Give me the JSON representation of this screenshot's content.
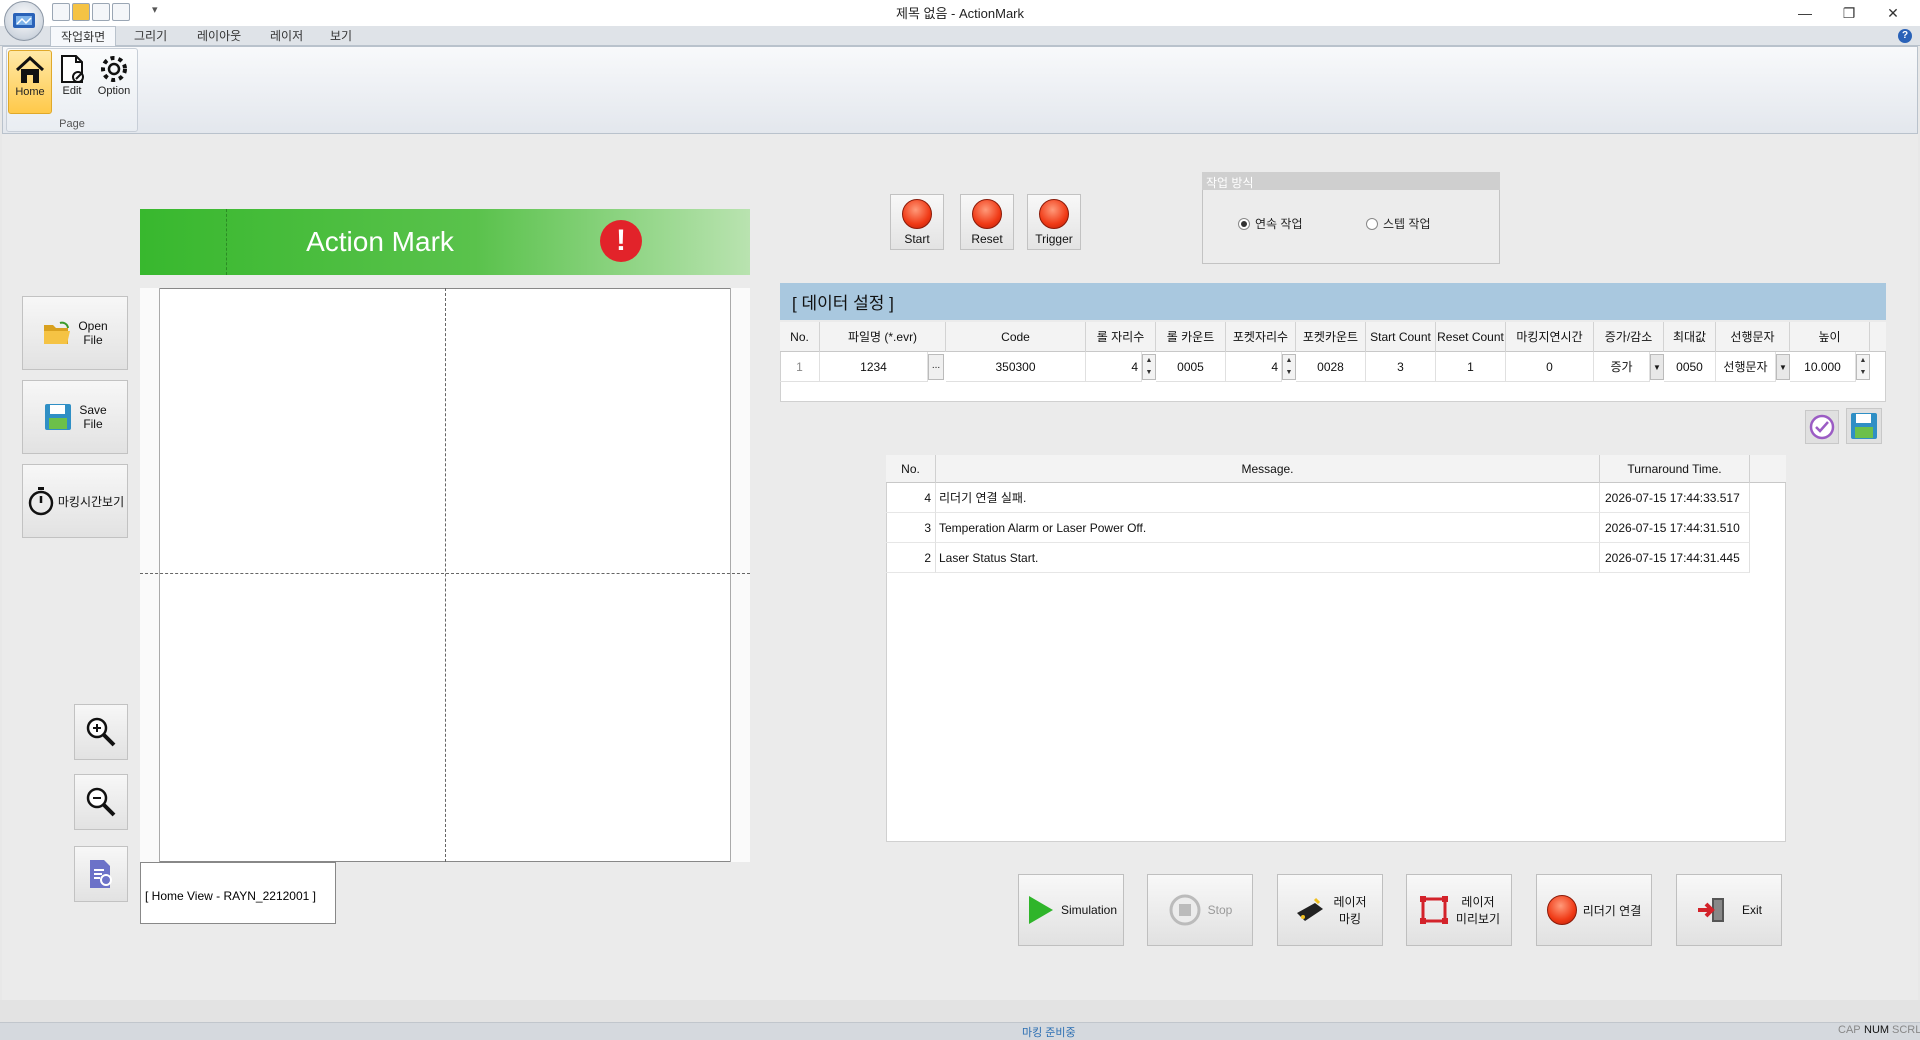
{
  "window": {
    "title": "제목 없음 - ActionMark",
    "minimize": "—",
    "maximize": "❐",
    "close": "✕"
  },
  "ribbon": {
    "tabs": [
      "작업화면",
      "그리기",
      "레이아웃",
      "레이저",
      "보기"
    ],
    "group_label": "Page",
    "buttons": [
      {
        "label": "Home",
        "icon": "home-icon"
      },
      {
        "label": "Edit",
        "icon": "edit-icon"
      },
      {
        "label": "Option",
        "icon": "gear-icon"
      }
    ],
    "help": "?"
  },
  "brand": {
    "title": "Action Mark",
    "warning": "!"
  },
  "left_tools": {
    "open": "Open\nFile",
    "save": "Save\nFile",
    "timer": "마킹시간보기"
  },
  "home_view": "[  Home View - RAYN_2212001  ]",
  "controls": {
    "start": "Start",
    "reset": "Reset",
    "trigger": "Trigger"
  },
  "work_mode": {
    "title": "작업 방식",
    "options": [
      "연속 작업",
      "스텝 작업"
    ],
    "selected": "연속 작업"
  },
  "data_settings": {
    "title": "[ 데이터 설정 ]",
    "columns": [
      "No.",
      "파일명 (*.evr)",
      "Code",
      "롤 자리수",
      "롤 카운트",
      "포켓자리수",
      "포켓카운트",
      "Start Count",
      "Reset Count",
      "마킹지연시간",
      "증가/감소",
      "최대값",
      "선행문자",
      "높이"
    ],
    "row": {
      "no": "1",
      "file": "1234",
      "code": "350300",
      "roll_digits": "4",
      "roll_count": "0005",
      "pocket_digits": "4",
      "pocket_count": "0028",
      "start_count": "3",
      "reset_count": "1",
      "delay": "0",
      "direction": "증가",
      "max": "0050",
      "prefix": "선행문자",
      "height": "10.000"
    },
    "ellipsis": "..."
  },
  "log": {
    "columns": [
      "No.",
      "Message.",
      "Turnaround Time."
    ],
    "rows": [
      {
        "no": "4",
        "message": "리더기 연결 실패.",
        "time": "2026-07-15 17:44:33.517"
      },
      {
        "no": "3",
        "message": "Temperation Alarm or Laser Power Off.",
        "time": "2026-07-15 17:44:31.510"
      },
      {
        "no": "2",
        "message": "Laser Status Start.",
        "time": "2026-07-15 17:44:31.445"
      }
    ]
  },
  "actions": {
    "simulation": "Simulation",
    "stop": "Stop",
    "laser_mark": "레이저\n마킹",
    "laser_preview": "레이저\n미리보기",
    "reader_connect": "리더기 연결",
    "exit": "Exit"
  },
  "status": {
    "text": "마킹 준비중",
    "caps": "CAP",
    "num": "NUM",
    "scrl": "SCRL"
  }
}
